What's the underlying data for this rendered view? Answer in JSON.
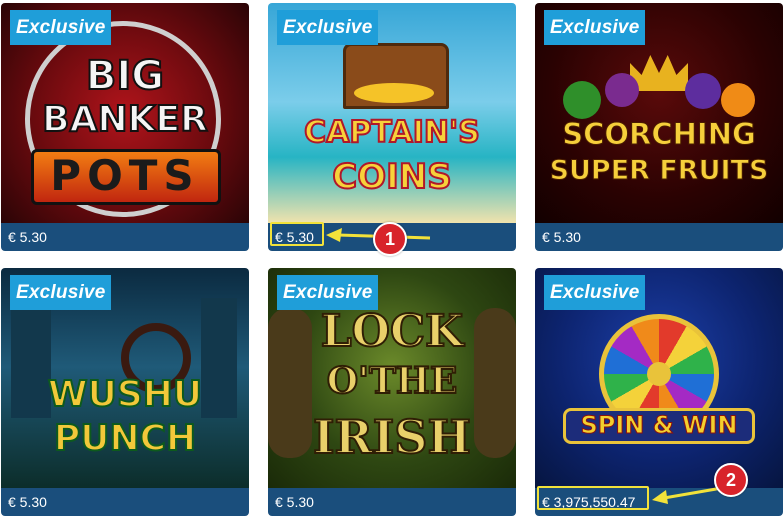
{
  "games": [
    {
      "title_lines": [
        "BIG",
        "BANKER",
        "POTS"
      ],
      "badge": "Exclusive",
      "price": "€ 5.30"
    },
    {
      "title_lines": [
        "CAPTAIN'S",
        "COINS"
      ],
      "badge": "Exclusive",
      "price": "€ 5.30"
    },
    {
      "title_lines": [
        "SCORCHING",
        "SUPER FRUITS"
      ],
      "badge": "Exclusive",
      "price": "€ 5.30"
    },
    {
      "title_lines": [
        "WUSHU",
        "PUNCH"
      ],
      "badge": "Exclusive",
      "price": "€ 5.30"
    },
    {
      "title_lines": [
        "LOCK",
        "O'THE",
        "IRISH"
      ],
      "badge": "Exclusive",
      "price": "€ 5.30"
    },
    {
      "title_lines": [
        "SPIN & WIN"
      ],
      "badge": "Exclusive",
      "price": "€ 3,975,550.47"
    }
  ],
  "annotations": [
    {
      "number": "1"
    },
    {
      "number": "2"
    }
  ],
  "colors": {
    "badge": "#1f9ed9",
    "price_bar": "#1a4e7c",
    "highlight": "#f2e23a",
    "marker": "#d8232a"
  }
}
